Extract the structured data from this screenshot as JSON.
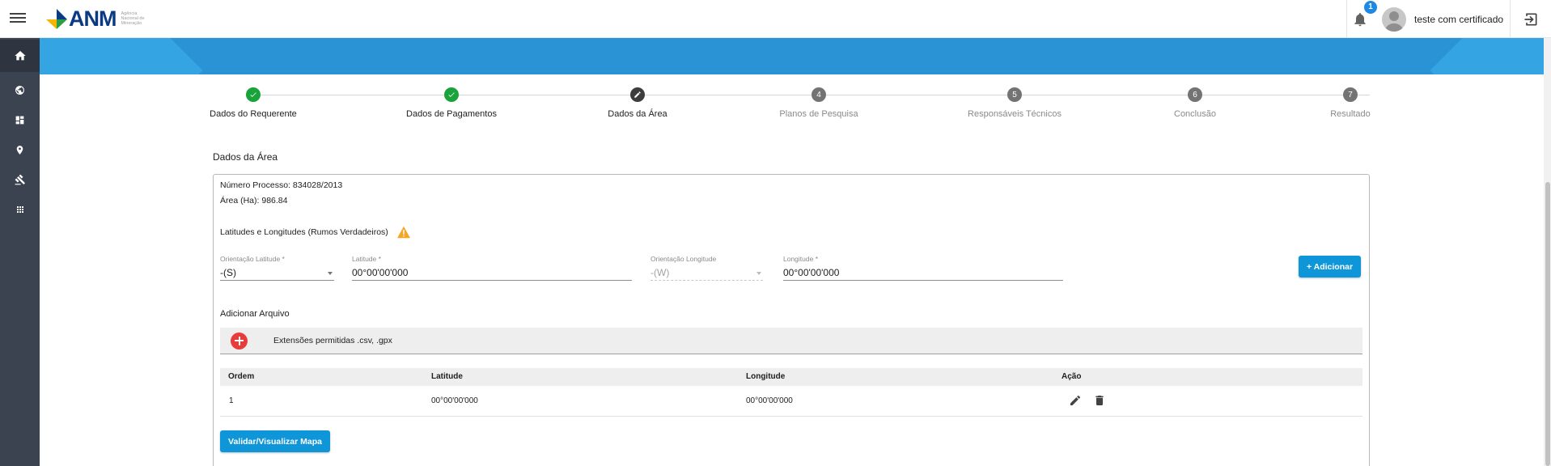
{
  "header": {
    "logo_text": "ANM",
    "logo_subtitle": "Agência Nacional de Mineração",
    "notification_count": "1",
    "user_name": "teste com certificado"
  },
  "sidebar": {
    "items": [
      {
        "icon": "home-icon"
      },
      {
        "icon": "globe-icon"
      },
      {
        "icon": "dashboard-icon"
      },
      {
        "icon": "location-pin-icon"
      },
      {
        "icon": "gavel-icon"
      },
      {
        "icon": "apps-grid-icon"
      }
    ]
  },
  "stepper": {
    "steps": [
      {
        "label": "Dados do Requerente",
        "state": "done",
        "number": "1"
      },
      {
        "label": "Dados de Pagamentos",
        "state": "done",
        "number": "2"
      },
      {
        "label": "Dados da Área",
        "state": "current",
        "number": "3"
      },
      {
        "label": "Planos de Pesquisa",
        "state": "todo",
        "number": "4"
      },
      {
        "label": "Responsáveis Técnicos",
        "state": "todo",
        "number": "5"
      },
      {
        "label": "Conclusão",
        "state": "todo",
        "number": "6"
      },
      {
        "label": "Resultado",
        "state": "todo",
        "number": "7"
      }
    ]
  },
  "section_title": "Dados da Área",
  "card": {
    "processo_label": "Número Processo:",
    "processo_value": "834028/2013",
    "area_label": "Área (Ha):",
    "area_value": "986.84",
    "lat_long_title": "Latitudes e Longitudes (Rumos Verdadeiros)",
    "fields": {
      "orient_lat_label": "Orientação Latitude *",
      "orient_lat_value": "-(S)",
      "latitude_label": "Latitude *",
      "latitude_value": "00°00'00'000",
      "orient_long_label": "Orientação Longitude",
      "orient_long_value": "-(W)",
      "longitude_label": "Longitude *",
      "longitude_value": "00°00'00'000"
    },
    "add_button": "+ Adicionar",
    "file_title": "Adicionar Arquivo",
    "file_extensions": "Extensões permitidas .csv, .gpx",
    "table": {
      "headers": [
        "Ordem",
        "Latitude",
        "Longitude",
        "Ação"
      ],
      "rows": [
        {
          "ordem": "1",
          "latitude": "00°00'00'000",
          "longitude": "00°00'00'000"
        }
      ]
    },
    "validate_button": "Validar/Visualizar Mapa"
  },
  "colors": {
    "primary": "#0f96d8",
    "banner": "#2a93d5",
    "sidebar": "#3b4350",
    "done": "#1aa33a",
    "warning": "#f5a623",
    "danger": "#ea3b3b"
  }
}
